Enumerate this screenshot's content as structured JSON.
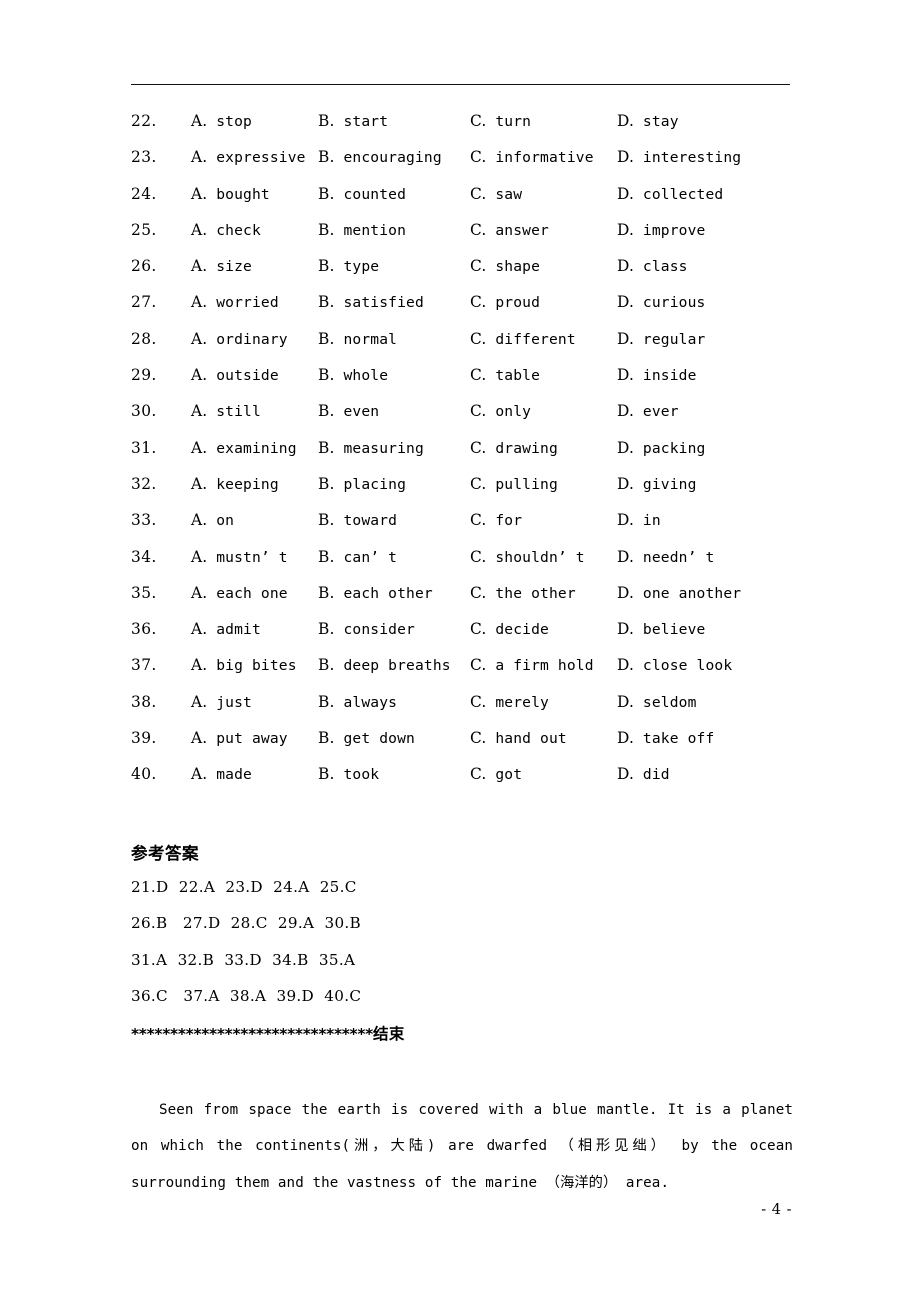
{
  "page": {
    "page_number_label": "- 4 -",
    "has_header_rule": true
  },
  "questions": {
    "columns": [
      "A.",
      "B.",
      "C.",
      "D."
    ],
    "rows": [
      {
        "num": "22.",
        "a": "stop",
        "b": "start",
        "c": "turn",
        "d": "stay"
      },
      {
        "num": "23.",
        "a": "expressive",
        "b": "encouraging",
        "c": "informative",
        "d": "interesting"
      },
      {
        "num": "24.",
        "a": "bought",
        "b": "counted",
        "c": "saw",
        "d": "collected"
      },
      {
        "num": "25.",
        "a": "check",
        "b": "mention",
        "c": "answer",
        "d": "improve"
      },
      {
        "num": "26.",
        "a": "size",
        "b": "type",
        "c": "shape",
        "d": "class"
      },
      {
        "num": "27.",
        "a": "worried",
        "b": "satisfied",
        "c": "proud",
        "d": "curious"
      },
      {
        "num": "28.",
        "a": "ordinary",
        "b": "normal",
        "c": "different",
        "d": "regular"
      },
      {
        "num": "29.",
        "a": "outside",
        "b": "whole",
        "c": "table",
        "d": "inside"
      },
      {
        "num": "30.",
        "a": "still",
        "b": "even",
        "c": "only",
        "d": "ever"
      },
      {
        "num": "31.",
        "a": "examining",
        "b": "measuring",
        "c": "drawing",
        "d": "packing"
      },
      {
        "num": "32.",
        "a": "keeping",
        "b": "placing",
        "c": "pulling",
        "d": "giving"
      },
      {
        "num": "33.",
        "a": "on",
        "b": "toward",
        "c": "for",
        "d": "in"
      },
      {
        "num": "34.",
        "a": "mustn’ t",
        "b": "can’ t",
        "c": "shouldn’ t",
        "d": "needn’ t"
      },
      {
        "num": "35.",
        "a": "each one",
        "b": "each other",
        "c": "the other",
        "d": "one another"
      },
      {
        "num": "36.",
        "a": "admit",
        "b": "consider",
        "c": "decide",
        "d": "believe"
      },
      {
        "num": "37.",
        "a": "big bites",
        "b": "deep breaths",
        "c": "a firm hold",
        "d": "close look"
      },
      {
        "num": "38.",
        "a": "just",
        "b": "always",
        "c": "merely",
        "d": "seldom"
      },
      {
        "num": "39.",
        "a": "put away",
        "b": "get down",
        "c": "hand out",
        "d": "take off"
      },
      {
        "num": "40.",
        "a": "made",
        "b": "took",
        "c": "got",
        "d": "did"
      }
    ]
  },
  "answers": {
    "heading": "参考答案",
    "lines": [
      "21.D  22.A  23.D  24.A  25.C",
      "26.B   27.D  28.C  29.A  30.B",
      "31.A  32.B  33.D  34.B  35.A",
      "36.C   37.A  38.A  39.D  40.C"
    ]
  },
  "divider": {
    "asterisks": "*******************************",
    "end_label": "结束"
  },
  "passage": {
    "text": "Seen from space the earth is covered with a blue mantle. It is a planet on which the continents(洲，大陆) are dwarfed （相形见绌） by the ocean surrounding them and the vastness of the marine （海洋的） area."
  }
}
